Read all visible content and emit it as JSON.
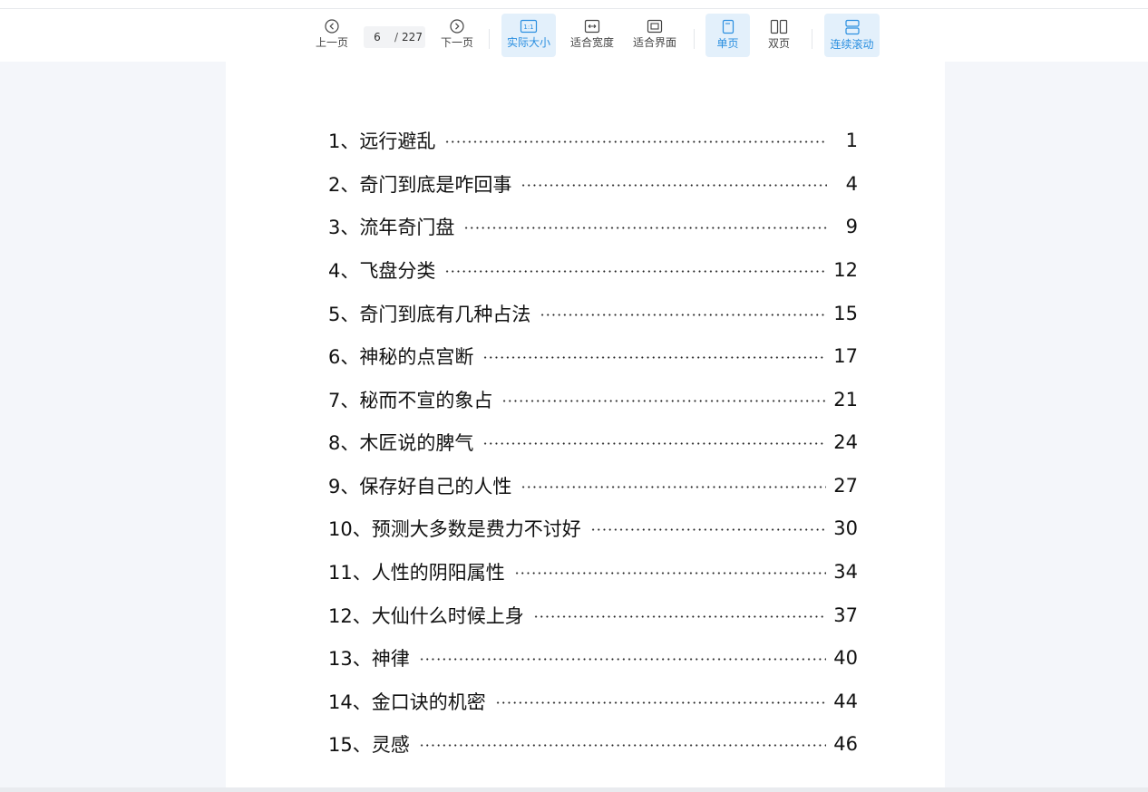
{
  "toolbar": {
    "prev_label": "上一页",
    "next_label": "下一页",
    "current_page": "6",
    "page_separator": "/",
    "total_pages": "227",
    "actual_size_label": "实际大小",
    "actual_size_icon_text": "1:1",
    "fit_width_label": "适合宽度",
    "fit_page_label": "适合界面",
    "single_page_label": "单页",
    "double_page_label": "双页",
    "continuous_label": "连续滚动",
    "active": [
      "actual_size",
      "single_page",
      "continuous"
    ],
    "accent_color": "#2b8fe0"
  },
  "toc": {
    "items": [
      {
        "title": "1、远行避乱",
        "page": "1"
      },
      {
        "title": "2、奇门到底是咋回事",
        "page": "4"
      },
      {
        "title": "3、流年奇门盘",
        "page": "9"
      },
      {
        "title": "4、飞盘分类",
        "page": "12"
      },
      {
        "title": "5、奇门到底有几种占法",
        "page": "15"
      },
      {
        "title": "6、神秘的点宫断",
        "page": "17"
      },
      {
        "title": "7、秘而不宣的象占",
        "page": "21"
      },
      {
        "title": "8、木匠说的脾气",
        "page": "24"
      },
      {
        "title": "9、保存好自己的人性",
        "page": "27"
      },
      {
        "title": "10、预测大多数是费力不讨好",
        "page": "30"
      },
      {
        "title": "11、人性的阴阳属性",
        "page": "34"
      },
      {
        "title": "12、大仙什么时候上身",
        "page": "37"
      },
      {
        "title": "13、神律",
        "page": "40"
      },
      {
        "title": "14、金口诀的机密",
        "page": "44"
      },
      {
        "title": "15、灵感",
        "page": "46"
      }
    ]
  }
}
